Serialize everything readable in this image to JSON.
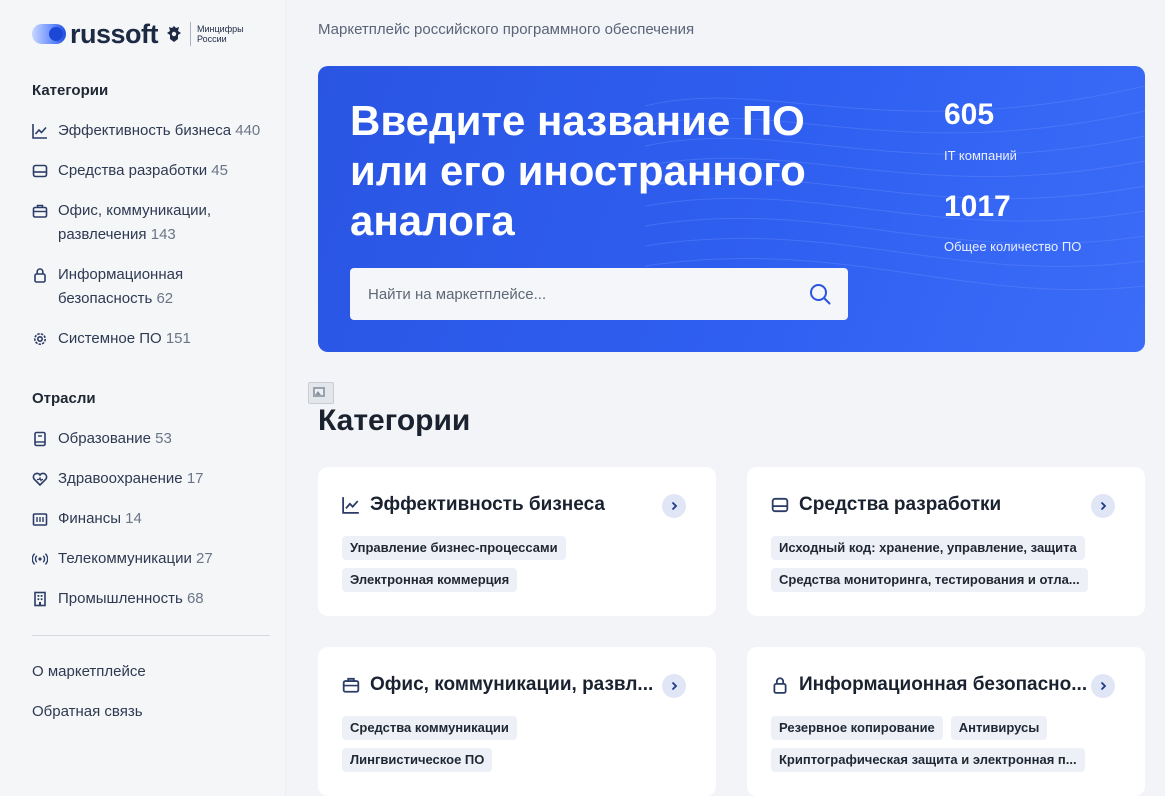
{
  "brand": {
    "name": "russoft",
    "ministry_line1": "Минцифры",
    "ministry_line2": "России"
  },
  "sidebar": {
    "categories_heading": "Категории",
    "categories": [
      {
        "icon": "chart-line-icon",
        "label": "Эффективность бизнеса",
        "count": "440"
      },
      {
        "icon": "server-icon",
        "label": "Средства разработки",
        "count": "45"
      },
      {
        "icon": "briefcase-icon",
        "label_line1": "Офис, коммуникации,",
        "label_line2": "развлечения",
        "count": "143"
      },
      {
        "icon": "lock-icon",
        "label_line1": "Информационная",
        "label_line2": "безопасность",
        "count": "62"
      },
      {
        "icon": "gear-icon",
        "label": "Системное ПО",
        "count": "151"
      }
    ],
    "industries_heading": "Отрасли",
    "industries": [
      {
        "icon": "book-icon",
        "label": "Образование",
        "count": "53"
      },
      {
        "icon": "heart-icon",
        "label": "Здравоохранение",
        "count": "17"
      },
      {
        "icon": "bank-icon",
        "label": "Финансы",
        "count": "14"
      },
      {
        "icon": "antenna-icon",
        "label": "Телекоммуникации",
        "count": "27"
      },
      {
        "icon": "building-icon",
        "label": "Промышленность",
        "count": "68"
      }
    ],
    "links": [
      "О маркетплейсе",
      "Обратная связь"
    ]
  },
  "header": {
    "caption": "Маркетплейс российского программного обеспечения"
  },
  "hero": {
    "title_line1": "Введите название ПО",
    "title_line2": "или его иностранного",
    "title_line3": "аналога",
    "search_placeholder": "Найти на маркетплейсе...",
    "stats": [
      {
        "value": "605",
        "label": "IT компаний"
      },
      {
        "value": "1017",
        "label": "Общее количество ПО"
      }
    ]
  },
  "main": {
    "section_title": "Категории",
    "cards": [
      {
        "icon": "chart-line-icon",
        "title": "Эффективность бизнеса",
        "tags": [
          "Управление бизнес-процессами",
          "Электронная коммерция"
        ]
      },
      {
        "icon": "server-icon",
        "title": "Средства разработки",
        "tags": [
          "Исходный код: хранение, управление, защита",
          "Средства мониторинга, тестирования и отла..."
        ]
      },
      {
        "icon": "briefcase-icon",
        "title": "Офис, коммуникации, развл...",
        "tags": [
          "Средства коммуникации",
          "Лингвистическое ПО"
        ]
      },
      {
        "icon": "lock-icon",
        "title": "Информационная безопасно...",
        "tags": [
          "Резервное копирование",
          "Антивирусы",
          "Криптографическая защита и электронная п..."
        ]
      }
    ]
  },
  "colors": {
    "accent": "#2f5ff0",
    "sidebar_bg": "#f5f6f8",
    "page_bg": "#f2f4f7",
    "tag_bg": "#edf0f6"
  }
}
